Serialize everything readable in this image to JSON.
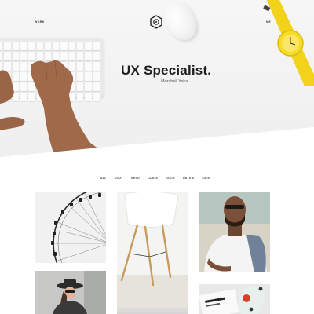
{
  "nav": {
    "left_label": "WORK",
    "right_label": "ME"
  },
  "hero": {
    "title": "UX Specialist.",
    "subtitle": "Morshell Yeka"
  },
  "filters": [
    "ALL",
    "UI/UY",
    "GHTO",
    "CLATE",
    "IDATE",
    "DATE'S",
    "CATE"
  ],
  "gallery": [
    {
      "name": "ferris-wheel"
    },
    {
      "name": "white-chair"
    },
    {
      "name": "man-with-backpack"
    },
    {
      "name": "woman-with-hat"
    },
    {
      "name": "partial-image"
    },
    {
      "name": "magazine-and-skateboard"
    }
  ],
  "colors": {
    "accent_yellow": "#f2d21b",
    "hero_bg": "#f2f2f2",
    "text_dark": "#1e1e1e"
  }
}
